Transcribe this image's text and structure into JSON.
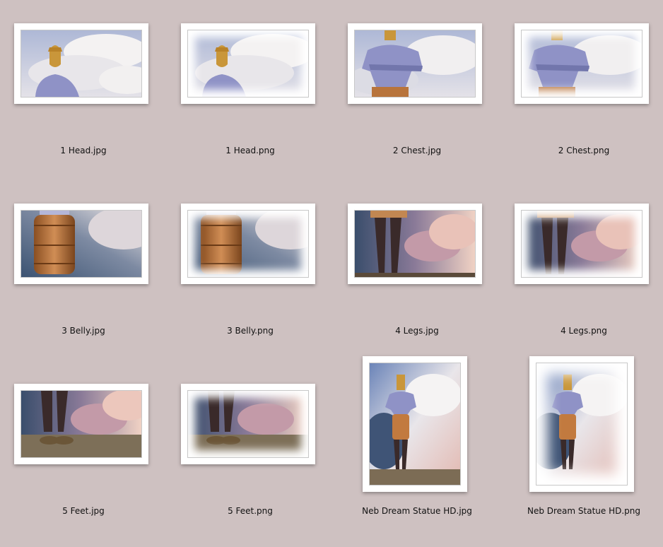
{
  "files": [
    {
      "name": "1 Head.jpg"
    },
    {
      "name": "1 Head.png"
    },
    {
      "name": "2 Chest.jpg"
    },
    {
      "name": "2 Chest.png"
    },
    {
      "name": "3 Belly.jpg"
    },
    {
      "name": "3 Belly.png"
    },
    {
      "name": "4 Legs.jpg"
    },
    {
      "name": "4 Legs.png"
    },
    {
      "name": "5 Feet.jpg"
    },
    {
      "name": "5 Feet.png"
    },
    {
      "name": "Neb Dream Statue HD.jpg"
    },
    {
      "name": "Neb Dream Statue HD.png"
    }
  ],
  "colors": {
    "background": "#cec1c1",
    "frame": "#ffffff"
  }
}
